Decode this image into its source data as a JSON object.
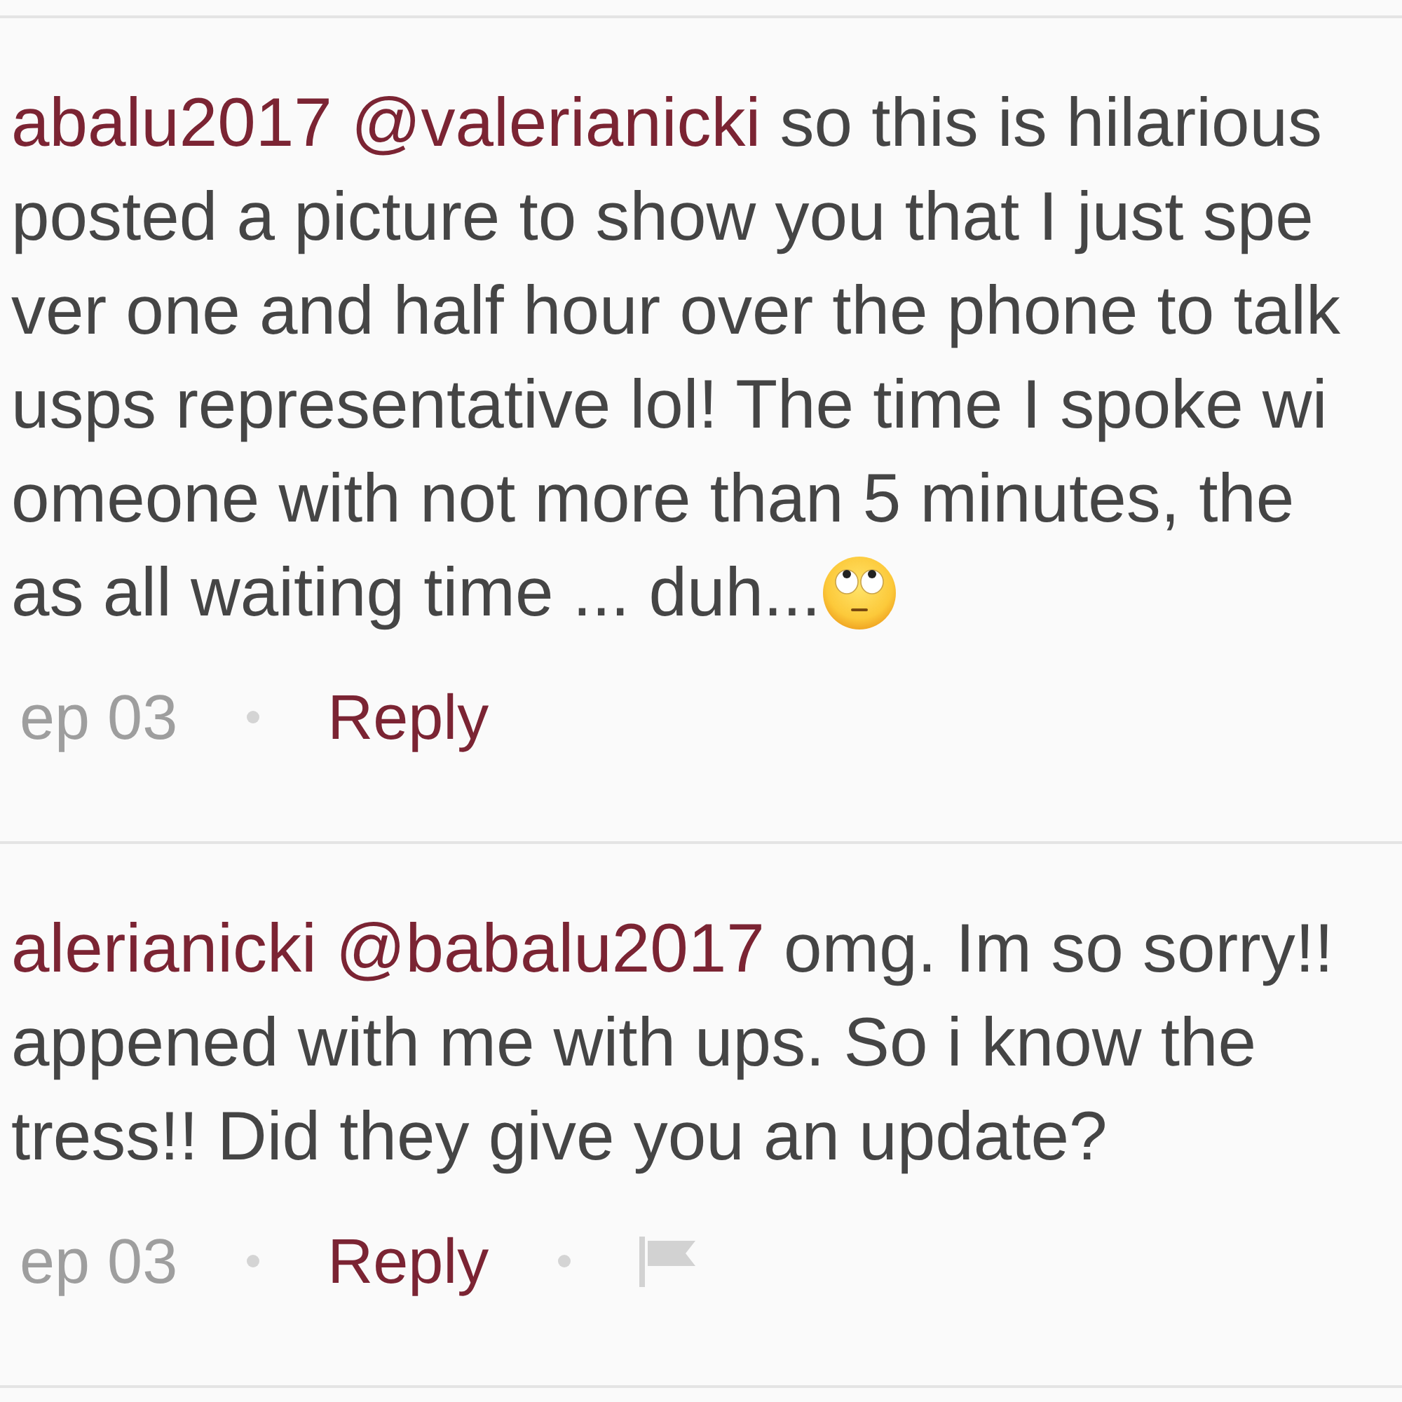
{
  "comments": [
    {
      "author": "abalu2017",
      "mention": "@valerianicki",
      "lines": [
        "so this is hilarious",
        "posted a picture to show you that I just spe",
        "ver one and half hour over the phone to talk",
        "usps representative lol! The time I spoke wi",
        "omeone with not more than 5 minutes, the",
        "as all waiting time ... duh..."
      ],
      "emoji": true,
      "date": "ep 03",
      "actions": [
        {
          "kind": "reply",
          "label": "Reply"
        }
      ]
    },
    {
      "author": "alerianicki",
      "mention": "@babalu2017",
      "lines": [
        "omg. Im so sorry!!",
        "appened with me with ups. So i know the",
        "tress!! Did they give you an update?"
      ],
      "date": "ep 03",
      "actions": [
        {
          "kind": "reply",
          "label": "Reply"
        },
        {
          "kind": "flag"
        }
      ]
    }
  ]
}
